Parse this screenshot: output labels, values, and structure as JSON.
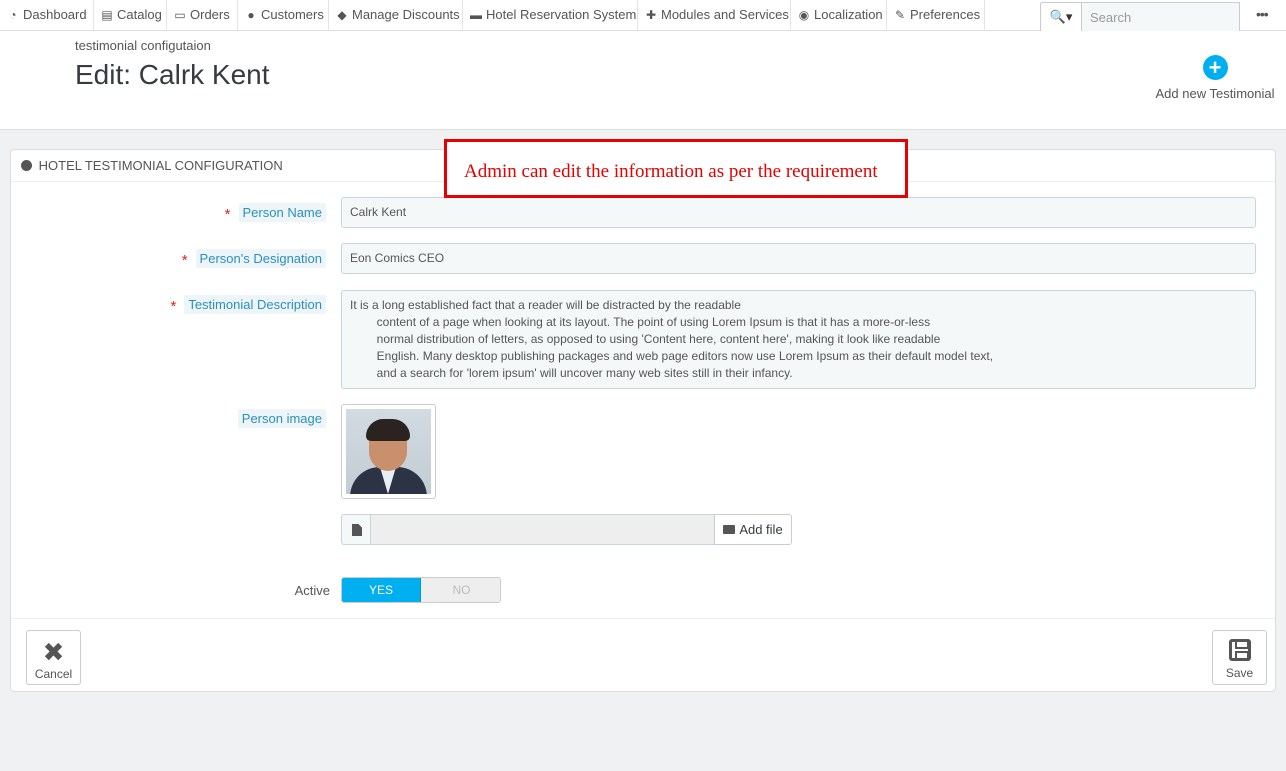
{
  "nav": {
    "items": [
      {
        "label": "Dashboard",
        "icon": "dashboard-icon",
        "glyph": "◔"
      },
      {
        "label": "Catalog",
        "icon": "book-icon",
        "glyph": "▤"
      },
      {
        "label": "Orders",
        "icon": "credit-card-icon",
        "glyph": "▭"
      },
      {
        "label": "Customers",
        "icon": "users-icon",
        "glyph": "●"
      },
      {
        "label": "Manage Discounts",
        "icon": "tags-icon",
        "glyph": "◆"
      },
      {
        "label": "Hotel Reservation System",
        "icon": "bed-icon",
        "glyph": "▬"
      },
      {
        "label": "Modules and Services",
        "icon": "puzzle-icon",
        "glyph": "✚"
      },
      {
        "label": "Localization",
        "icon": "globe-icon",
        "glyph": "◉"
      },
      {
        "label": "Preferences",
        "icon": "wrench-icon",
        "glyph": "✎"
      }
    ],
    "search_button": "🔍▾",
    "search_placeholder": "Search",
    "more": "•••"
  },
  "header": {
    "breadcrumb": "testimonial configutaion",
    "title": "Edit: Calrk Kent",
    "add_new_label": "Add new Testimonial",
    "add_new_glyph": "+"
  },
  "panel": {
    "heading": "HOTEL TESTIMONIAL CONFIGURATION",
    "fields": {
      "person_name": {
        "label": "Person Name",
        "value": "Calrk Kent",
        "required": "*"
      },
      "designation": {
        "label": "Person's Designation",
        "value": "Eon Comics CEO",
        "required": "*"
      },
      "description": {
        "label": "Testimonial Description",
        "required": "*",
        "value": "It is a long established fact that a reader will be distracted by the readable\n        content of a page when looking at its layout. The point of using Lorem Ipsum is that it has a more-or-less\n        normal distribution of letters, as opposed to using 'Content here, content here', making it look like readable\n        English. Many desktop publishing packages and web page editors now use Lorem Ipsum as their default model text,\n        and a search for 'lorem ipsum' will uncover many web sites still in their infancy."
      },
      "image": {
        "label": "Person image",
        "add_file": "Add file"
      },
      "active": {
        "label": "Active",
        "yes": "YES",
        "no": "NO",
        "selected": "YES"
      }
    },
    "footer": {
      "cancel_label": "Cancel",
      "cancel_glyph": "✖",
      "save_label": "Save"
    }
  },
  "annotation": {
    "text": "Admin can edit the information as per the requirement",
    "color": "#e60000"
  },
  "colors": {
    "accent": "#00aff0",
    "required": "#e62020",
    "label_hint": "#2a8fbd"
  }
}
